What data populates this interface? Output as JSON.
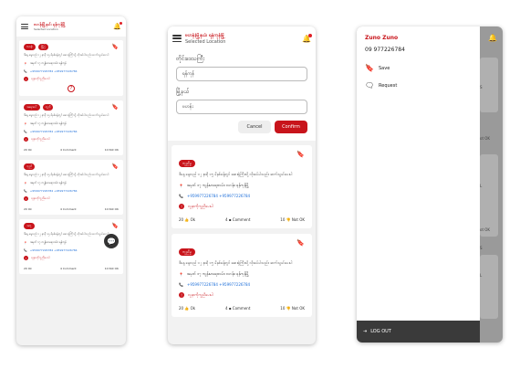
{
  "app": {
    "title": "ဗဟန်းမြို့နယ်၊ ရန်ကုန်မြို့",
    "subtitle": "Selected Location"
  },
  "screen1": {
    "cards": [
      {
        "badges": [
          "ဗဟန်း",
          "မြို့ပြ"
        ],
        "desc": "ဒီနေ့ နေ့လည် ၁၂ နာရီ ၁၅ မိနစ်ခန့်တွင် ဆေးရုံကြီးသို့ လိုအပ်ပါသည်။ ဆက်သွယ်ပေးပါ",
        "address": "အမှတ် ၁၇ ကျန်းမာရေးလမ်း၊ ရန်ကုန်",
        "phones": "+959977226784  +959977226784",
        "alert": "လူနာကိုကူညီပေးပါ",
        "likes": "",
        "comments": "",
        "notok": "",
        "help": true
      },
      {
        "badges": [
          "အရေးပေါ်",
          "ကူညီ"
        ],
        "desc": "ဒီနေ့ နေ့လည် ၁၂ နာရီ ၁၅ မိနစ်ခန့်တွင် ဆေးရုံကြီးသို့ လိုအပ်ပါသည်။ ဆက်သွယ်ပေးပါ",
        "address": "အမှတ် ၁၇ ကျန်းမာရေးလမ်း၊ ရန်ကုန်",
        "phones": "+959977226784  +959977226784",
        "alert": "လူနာကိုကူညီပေးပါ",
        "likes": "20 Ok",
        "comments": "4 Comment",
        "notok": "10 Not OK",
        "help": false
      },
      {
        "badges": [
          "ကူညီ"
        ],
        "desc": "ဒီနေ့ နေ့လည် ၁၂ နာရီ ၁၅ မိနစ်ခန့်တွင် ဆေးရုံကြီးသို့ လိုအပ်ပါသည်။ ဆက်သွယ်ပေးပါ",
        "address": "အမှတ် ၁၇ ကျန်းမာရေးလမ်း၊ ရန်ကုန်",
        "phones": "+959977226784  +959977226784",
        "alert": "လူနာကိုကူညီပေးပါ",
        "likes": "20 Ok",
        "comments": "4 Comment",
        "notok": "10 Not OK",
        "help": false
      },
      {
        "badges": [
          "အကူ"
        ],
        "desc": "ဒီနေ့ နေ့လည် ၁၂ နာရီ ၁၅ မိနစ်ခန့်တွင် ဆေးရုံကြီးသို့ လိုအပ်ပါသည်။ ဆက်သွယ်ပေးပါ",
        "address": "အမှတ် ၁၇ ကျန်းမာရေးလမ်း၊ ရန်ကုန်",
        "phones": "+959977226784  +959977226784",
        "alert": "လူနာကိုကူညီပေးပါ",
        "likes": "20 Ok",
        "comments": "4 Comment",
        "notok": "10 Not OK",
        "help": false
      }
    ]
  },
  "screen2": {
    "form": {
      "region_label": "တိုင်းဒေသကြီး",
      "region_value": "ရန်ကုန်",
      "township_label": "မြို့နယ်",
      "township_value": "ဗဟန်း",
      "cancel": "Cancel",
      "confirm": "Confirm"
    },
    "cards": [
      {
        "badge": "ကူညီမှု",
        "desc": "ဒီနေ့ နေ့လည် ၁၂ နာရီ ၁၅ မိနစ်ခန့်တွင် ဆေးရုံကြီးသို့ လိုအပ်ပါသည်။ ဆက်သွယ်ပေးပါ",
        "address": "အမှတ် ၁၇ ကျန်းမာရေးလမ်း၊ ဗဟန်း၊ ရန်ကုန်မြို့",
        "phones": "+959977226784  +959977226784",
        "alert": "လူနာကိုကူညီပေးပါ",
        "likes": "20",
        "ok": "Ok",
        "comments": "4",
        "comment": "Comment",
        "notok_count": "10",
        "notok": "Not OK"
      },
      {
        "badge": "ကူညီမှု",
        "desc": "ဒီနေ့ နေ့လည် ၁၂ နာရီ ၁၅ မိနစ်ခန့်တွင် ဆေးရုံကြီးသို့ လိုအပ်ပါသည်။ ဆက်သွယ်ပေးပါ",
        "address": "အမှတ် ၁၇ ကျန်းမာရေးလမ်း၊ ဗဟန်း၊ ရန်ကုန်မြို့",
        "phones": "+959977226784  +959977226784",
        "alert": "လူနာကိုကူညီပေးပါ",
        "likes": "20",
        "ok": "Ok",
        "comments": "4",
        "comment": "Comment",
        "notok_count": "10",
        "notok": "Not OK"
      }
    ]
  },
  "screen3": {
    "user_name": "Zuno Zuno",
    "user_phone": "09 977226784",
    "menu": [
      {
        "label": "Save",
        "icon": "bookmark-icon"
      },
      {
        "label": "Request",
        "icon": "chat-bubble-icon"
      }
    ],
    "logout": "LOG OUT",
    "bg_texts": [
      "S",
      "ot OK",
      "L",
      "ot OK",
      "S",
      "L"
    ]
  },
  "colors": {
    "brand_red": "#c8141b",
    "link_blue": "#1e6fd9"
  }
}
